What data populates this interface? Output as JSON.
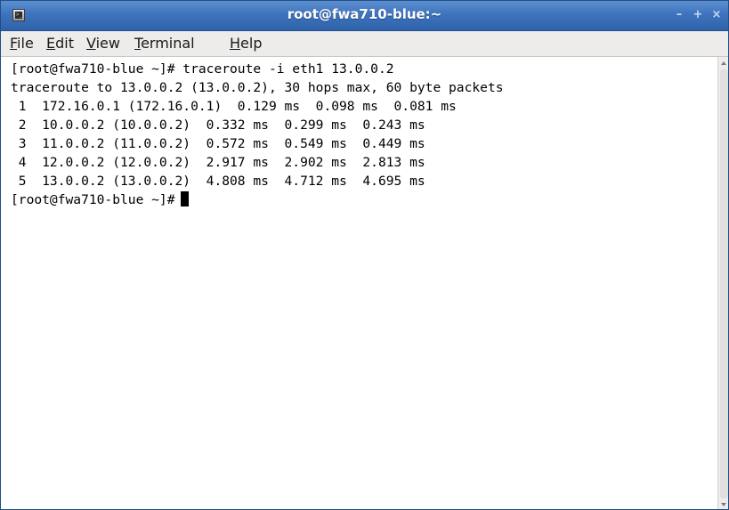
{
  "window": {
    "title": "root@fwa710-blue:~",
    "icon": "terminal-icon",
    "controls": {
      "minimize": "–",
      "maximize": "+",
      "close": "×"
    },
    "colors": {
      "titlebar": "#3e74bd",
      "title_text": "#ffffff",
      "menubar": "#edeceb",
      "terminal_bg": "#ffffff",
      "terminal_fg": "#000000"
    }
  },
  "menu": {
    "items": [
      {
        "mnemonic": "F",
        "rest": "ile"
      },
      {
        "mnemonic": "E",
        "rest": "dit"
      },
      {
        "mnemonic": "V",
        "rest": "iew"
      },
      {
        "mnemonic": "T",
        "rest": "erminal"
      },
      {
        "mnemonic": "H",
        "rest": "elp"
      }
    ]
  },
  "terminal": {
    "lines": [
      "[root@fwa710-blue ~]# traceroute -i eth1 13.0.0.2",
      "traceroute to 13.0.0.2 (13.0.0.2), 30 hops max, 60 byte packets",
      " 1  172.16.0.1 (172.16.0.1)  0.129 ms  0.098 ms  0.081 ms",
      " 2  10.0.0.2 (10.0.0.2)  0.332 ms  0.299 ms  0.243 ms",
      " 3  11.0.0.2 (11.0.0.2)  0.572 ms  0.549 ms  0.449 ms",
      " 4  12.0.0.2 (12.0.0.2)  2.917 ms  2.902 ms  2.813 ms",
      " 5  13.0.0.2 (13.0.0.2)  4.808 ms  4.712 ms  4.695 ms"
    ],
    "prompt": "[root@fwa710-blue ~]#"
  }
}
